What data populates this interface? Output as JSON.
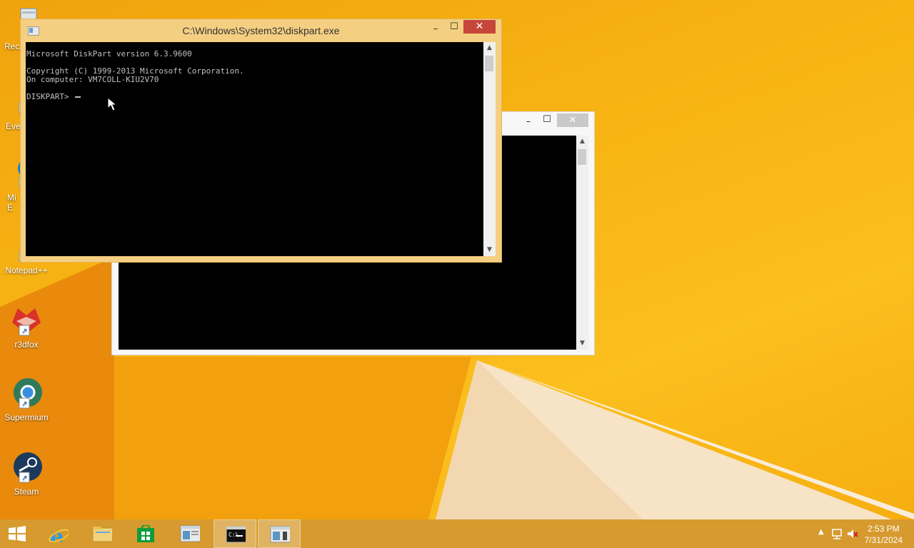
{
  "desktop": {
    "icons": [
      {
        "label": "Rec",
        "name": "recycle-bin-icon"
      },
      {
        "label": "Eve",
        "name": "everything-icon"
      },
      {
        "label": "Mi\nE",
        "name": "microsoft-edge-icon"
      },
      {
        "label": "Notepad++",
        "name": "notepad-plus-plus-icon"
      },
      {
        "label": "r3dfox",
        "name": "r3dfox-icon"
      },
      {
        "label": "Supermium",
        "name": "supermium-icon"
      },
      {
        "label": "Steam",
        "name": "steam-icon"
      }
    ]
  },
  "front_window": {
    "title": "C:\\Windows\\System32\\diskpart.exe",
    "controls": {
      "minimize": "–",
      "maximize": "☐",
      "close": "✕"
    },
    "console_lines": [
      "Microsoft DiskPart version 6.3.9600",
      "",
      "Copyright (C) 1999-2013 Microsoft Corporation.",
      "On computer: VM7COLL-KIU2V70",
      "",
      "DISKPART> "
    ]
  },
  "back_window": {
    "controls": {
      "minimize": "–",
      "maximize": "☐",
      "close": "✕"
    }
  },
  "taskbar": {
    "buttons": [
      {
        "name": "start-button",
        "icon": "windows-logo-icon"
      },
      {
        "name": "internet-explorer-button",
        "icon": "internet-explorer-icon"
      },
      {
        "name": "file-explorer-button",
        "icon": "folder-icon"
      },
      {
        "name": "store-button",
        "icon": "store-icon"
      },
      {
        "name": "window-app-button",
        "icon": "window-app-icon"
      },
      {
        "name": "command-prompt-button",
        "icon": "cmd-icon"
      },
      {
        "name": "diskpart-button",
        "icon": "window-app-icon"
      }
    ],
    "clock": {
      "time": "2:53 PM",
      "date": "7/31/2024"
    }
  },
  "colors": {
    "close_red": "#c7463a",
    "active_frame": "#f5cf81",
    "taskbar": "#d69a2e"
  }
}
